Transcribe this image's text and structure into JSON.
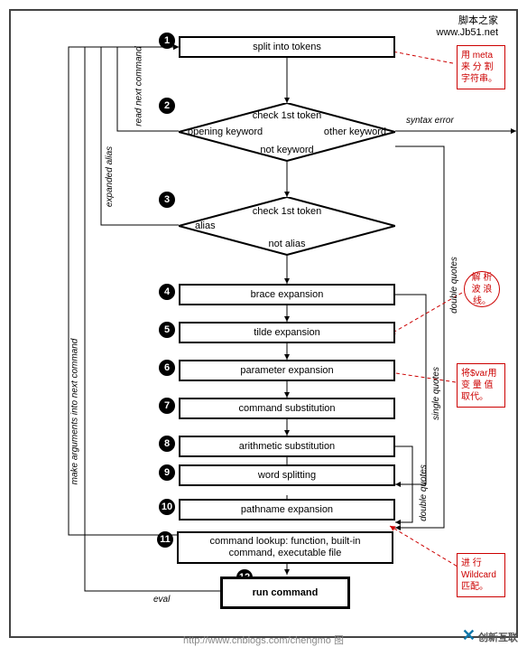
{
  "header": {
    "line1": "脚本之家",
    "line2": "www.Jb51.net"
  },
  "steps": {
    "s1": "split into tokens",
    "s2": {
      "top": "check 1st token",
      "left": "opening keyword",
      "right": "other keyword",
      "bottom": "not keyword"
    },
    "s3": {
      "top": "check 1st token",
      "left": "alias",
      "bottom": "not alias"
    },
    "s4": "brace expansion",
    "s5": "tilde expansion",
    "s6": "parameter expansion",
    "s7": "command substitution",
    "s8": "arithmetic substitution",
    "s9": "word splitting",
    "s10": "pathname expansion",
    "s11": "command lookup: function, built-in command, executable file",
    "s12": "run command"
  },
  "edges": {
    "syntax_error": "syntax error",
    "read_next": "read next command",
    "expanded_alias": "expanded alias",
    "make_args": "make arguments into next command",
    "double_quotes": "double quotes",
    "single_quotes": "single quotes",
    "eval": "eval"
  },
  "annotations": {
    "a1": "用 meta 来 分 割 字符串。",
    "a2": "解 析 波 浪 线。",
    "a3": "将$var用 变 量 值 取代。",
    "a4": "进 行 Wildcard 匹配。"
  },
  "footer": "http://www.cnblogs.com/chengmo   图",
  "brand": "创新互联"
}
